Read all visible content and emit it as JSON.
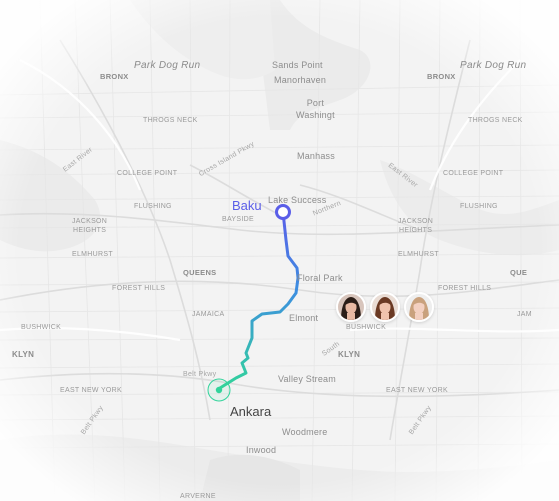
{
  "map": {
    "labels": {
      "park_dog_run_left": "Park Dog Run",
      "park_dog_run_right": "Park Dog Run",
      "bronx_left": "BRONX",
      "bronx_right": "BRONX",
      "sands_point": "Sands Point",
      "manorhaven": "Manorhaven",
      "port_washington": "Port\nWashingt",
      "throgs_neck_left": "THROGS NECK",
      "throgs_neck_right": "THROGS NECK",
      "manhasset": "Manhass",
      "east_river_left": "East River",
      "east_river_right": "East River",
      "college_point_left": "COLLEGE POINT",
      "college_point_right": "COLLEGE POINT",
      "cross_island_pkwy": "Cross Island Pkwy",
      "lake_success": "Lake Success",
      "northern": "Northern",
      "flushing_left": "FLUSHING",
      "flushing_right": "FLUSHING",
      "bayside": "BAYSIDE",
      "jackson_heights_left": "JACKSON\nHEIGHTS",
      "jackson_heights_right": "JACKSON\nHEIGHTS",
      "elmhurst_left": "ELMHURST",
      "elmhurst_right": "ELMHURST",
      "queens": "QUEENS",
      "floral_park": "Floral Park",
      "forest_hills_left": "FOREST HILLS",
      "forest_hills_right": "FOREST HILLS",
      "jamaica": "JAMAICA",
      "elmont": "Elmont",
      "bushwick_left": "BUSHWICK",
      "bushwick_right": "BUSHWICK",
      "klyn_left": "KLYN",
      "klyn_right": "KLYN",
      "belt_pkwy_a": "Belt Pkwy",
      "south": "South",
      "valley_stream": "Valley Stream",
      "east_new_york_left": "EAST NEW YORK",
      "east_new_york_right": "EAST NEW YORK",
      "belt_pkwy_b": "Belt Pkwy",
      "belt_pkwy_c": "Belt Pkwy",
      "woodmere": "Woodmere",
      "inwood": "Inwood",
      "arverne": "ARVERNE",
      "right_edge_que": "QUE",
      "right_edge_jam": "JAM"
    },
    "route": {
      "start_city": "Baku",
      "end_city": "Ankara",
      "start_color": "#5a5ee8",
      "end_color": "#32d39b"
    },
    "avatars": [
      {
        "name": "avatar-1",
        "hair": "#2b1d17",
        "skin": "#e8b9a3"
      },
      {
        "name": "avatar-2",
        "hair": "#6b3a24",
        "skin": "#f0c3ad"
      },
      {
        "name": "avatar-3",
        "hair": "#c9a17d",
        "skin": "#f3d0c1"
      }
    ]
  }
}
